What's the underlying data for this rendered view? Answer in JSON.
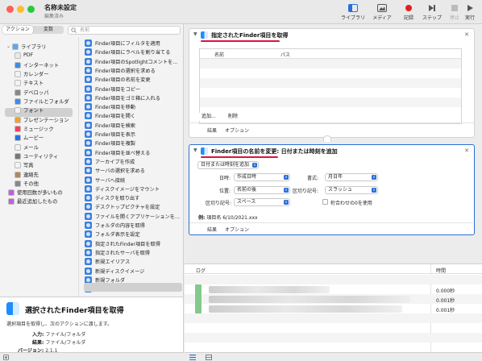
{
  "window": {
    "title": "名称未設定",
    "subtitle": "編集済み"
  },
  "toolbar": {
    "library": "ライブラリ",
    "media": "メディア",
    "record": "記録",
    "step": "ステップ",
    "stop": "停止",
    "run": "実行",
    "colors": {
      "record": "#e02020",
      "accent": "#2c6fd6"
    }
  },
  "left": {
    "tabs": [
      "アクション",
      "変数"
    ],
    "search_placeholder": "名前",
    "library": [
      {
        "label": "ライブラリ",
        "icon": "folder-icon",
        "color": "#5aa7f0"
      },
      {
        "label": "PDF",
        "icon": "pdf-icon",
        "color": "#e9e9e9"
      },
      {
        "label": "インターネット",
        "icon": "globe-icon",
        "color": "#3c8ce8"
      },
      {
        "label": "カレンダー",
        "icon": "calendar-icon",
        "color": "#f2f2f2"
      },
      {
        "label": "テキスト",
        "icon": "text-icon",
        "color": "#f2f2f2"
      },
      {
        "label": "デベロッパ",
        "icon": "hammer-icon",
        "color": "#888888"
      },
      {
        "label": "ファイルとフォルダ",
        "icon": "finder-icon",
        "color": "#3d8cf0"
      },
      {
        "label": "フォント",
        "icon": "font-icon",
        "color": "#f2f2f2"
      },
      {
        "label": "プレゼンテーション",
        "icon": "presentation-icon",
        "color": "#f0a030"
      },
      {
        "label": "ミュージック",
        "icon": "music-icon",
        "color": "#fa3c5a"
      },
      {
        "label": "ムービー",
        "icon": "movie-icon",
        "color": "#1f75e8"
      },
      {
        "label": "メール",
        "icon": "mail-icon",
        "color": "#f2f2f2"
      },
      {
        "label": "ユーティリティ",
        "icon": "automator-icon",
        "color": "#777777"
      },
      {
        "label": "写真",
        "icon": "photos-icon",
        "color": "#f2f2f2"
      },
      {
        "label": "連絡先",
        "icon": "contacts-icon",
        "color": "#b08a5a"
      },
      {
        "label": "その他",
        "icon": "gear-icon",
        "color": "#888888"
      },
      {
        "label": "使用回数が多いもの",
        "icon": "smart-folder-icon",
        "color": "#c060e0"
      },
      {
        "label": "最近追加したもの",
        "icon": "smart-folder-icon",
        "color": "#c060e0"
      }
    ],
    "actions": [
      "Finder項目にフィルタを適用",
      "Finder項目にラベルを割り当てる",
      "Finder項目のSpotlightコメントを設定",
      "Finder項目の選択を求める",
      "Finder項目の名前を変更",
      "Finder項目をコピー",
      "Finder項目をゴミ箱に入れる",
      "Finder項目を移動",
      "Finder項目を開く",
      "Finder項目を検索",
      "Finder項目を表示",
      "Finder項目を複製",
      "Finder項目を並べ替える",
      "アーカイブを作成",
      "サーバの選択を求める",
      "サーバへ接続",
      "ディスクイメージをマウント",
      "ディスクを取り出す",
      "デスクトップピクチャを設定",
      "ファイルを開くアプリケーションを設定",
      "フォルダの内容を取得",
      "フォルダ表示を設定",
      "指定されたFinder項目を取得",
      "指定されたサーバを取得",
      "新規エイリアス",
      "新規ディスクイメージ",
      "新規フォルダ",
      "選択されたFinder項目を取得"
    ]
  },
  "description": {
    "title": "選択されたFinder項目を取得",
    "text": "選択項目を取得し、次のアクションに渡します。",
    "input_label": "入力:",
    "input_value": "ファイル/フォルダ",
    "result_label": "結果:",
    "result_value": "ファイル/フォルダ",
    "version_label": "バージョン:",
    "version_value": "2.1.1"
  },
  "action1": {
    "title": "指定されたFinder項目を取得",
    "col_name": "名前",
    "col_path": "パス",
    "add": "追加...",
    "remove": "削除",
    "tab_result": "結果",
    "tab_option": "オプション"
  },
  "action2": {
    "title_bold": "Finder項目の名前を変更:",
    "title_rest": " 日付または時刻を追加",
    "mode": "日付または時刻を追加",
    "date_label": "日時:",
    "date_value": "作成日時",
    "format_label": "書式:",
    "format_value": "月日年",
    "position_label": "位置:",
    "position_value": "名前の後",
    "sep_label1": "区切り記号:",
    "sep_value1": "スラッシュ",
    "sep_label2": "区切り記号:",
    "sep_value2": "スペース",
    "zero_pad": "桁合わせの0を使用",
    "example_label": "例:",
    "example_value": "項目名 6/10/2021.xxx",
    "tab_result": "結果",
    "tab_option": "オプション"
  },
  "log": {
    "col_log": "ログ",
    "col_time": "時間",
    "times": [
      "0.000秒",
      "0.001秒",
      "0.001秒"
    ]
  }
}
